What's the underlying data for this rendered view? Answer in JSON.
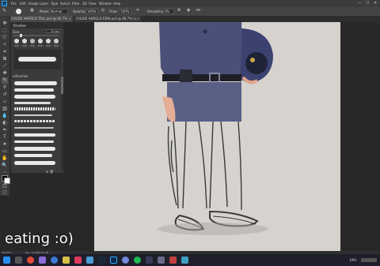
{
  "menubar": {
    "app_icon": "Ps",
    "items": [
      "File",
      "Edit",
      "Image",
      "Layer",
      "Type",
      "Select",
      "Filter",
      "3D",
      "View",
      "Window",
      "Help"
    ],
    "window_controls": [
      "—",
      "☐",
      "✕"
    ]
  },
  "options": {
    "mode_label": "Mode:",
    "mode_value": "Normal",
    "opacity_label": "Opacity:",
    "opacity_value": "100%",
    "flow_label": "Flow:",
    "flow_value": "100%",
    "smoothing_label": "Smoothing:",
    "smoothing_value": "0%"
  },
  "tabs": [
    {
      "label": "CHUDE HAROLD TALL.psd @ 66.7% (sketch, RGB/8) *"
    },
    {
      "label": "CHUDE HAROLD REIN.psd @ 66.7% (sketch, RGB/8) *"
    }
  ],
  "brush_panel": {
    "title": "Brushes",
    "size_label": "Size:",
    "size_value": "20 px",
    "tip_labels": [
      "400",
      "200",
      "200",
      "800",
      "400",
      "400"
    ],
    "folder_label": "Brushes"
  },
  "status": {
    "zoom": "66.67%",
    "doc": "Doc: 12.2M/175.2M"
  },
  "taskbar": {
    "icons": [
      "windows",
      "search",
      "task-view",
      "chrome",
      "edge",
      "files",
      "store",
      "mail",
      "steam",
      "discord",
      "spotify",
      "photoshop",
      "premiere",
      "obs",
      "settings",
      "folder",
      "mail2",
      "paint"
    ],
    "tray_time": "",
    "tray_lang": "ENG"
  },
  "overlay_caption": "eating :o)",
  "colors": {
    "foreground": "#000000",
    "background": "#ffffff",
    "accent": "#31a8ff",
    "uniform": "#4a5078",
    "canvas": "#d6d3cf"
  }
}
